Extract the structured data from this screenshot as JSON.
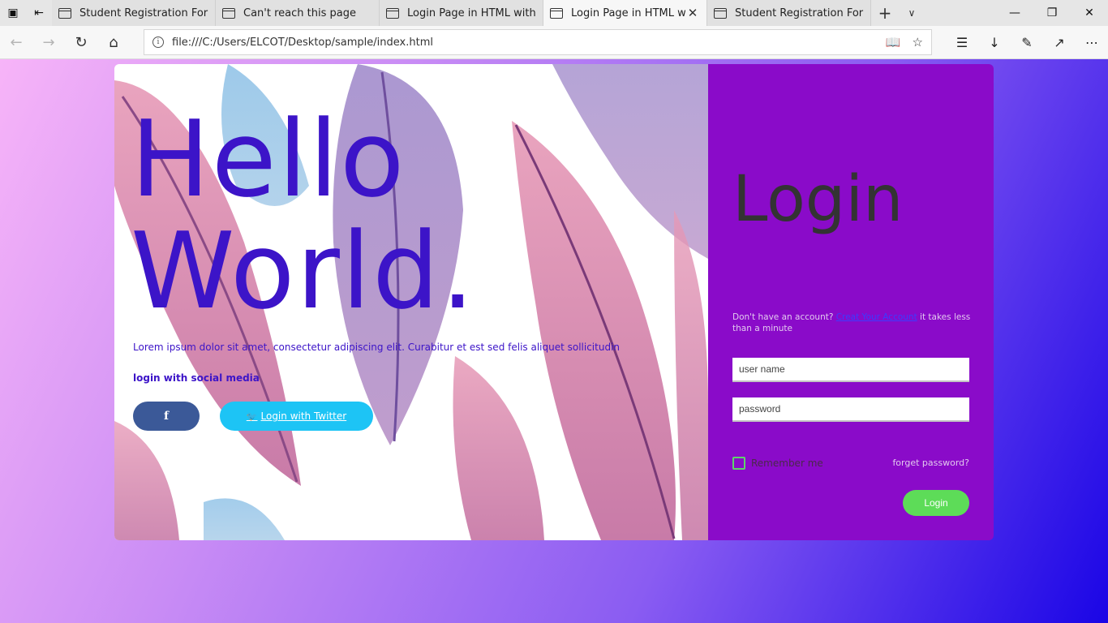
{
  "browser": {
    "tabs": [
      {
        "label": "Student Registration Form E",
        "active": false
      },
      {
        "label": "Can't reach this page",
        "active": false
      },
      {
        "label": "Login Page in HTML with CS",
        "active": false
      },
      {
        "label": "Login Page in HTML wit",
        "active": true
      },
      {
        "label": "Student Registration Form E",
        "active": false
      }
    ],
    "url": "file:///C:/Users/ELCOT/Desktop/sample/index.html",
    "icons": [
      "tabs-aside-icon",
      "set-aside-icon",
      "back-icon",
      "forward-icon",
      "refresh-icon",
      "home-icon",
      "reading-view-icon",
      "favorite-star-icon",
      "favorites-hub-icon",
      "downloads-icon",
      "notes-pen-icon",
      "share-icon",
      "more-icon"
    ]
  },
  "page": {
    "hero": {
      "line1": "Hello",
      "line2": "World."
    },
    "lorem": "Lorem ipsum dolor sit amet, consectetur adipiscing elit. Curabitur et est sed felis aliquet sollicitudin",
    "social_title": "login with social media",
    "facebook_label": "f",
    "twitter_label": "Login with Twitter"
  },
  "login": {
    "title": "Login",
    "signup_prefix": "Don't have an account?",
    "signup_link": "Creat Your Account",
    "signup_suffix": "it takes less than a minute",
    "username_placeholder": "user name",
    "password_placeholder": "password",
    "remember_label": "Remember me",
    "forget_label": "forget password?",
    "login_button": "Login"
  },
  "colors": {
    "hero_text": "#3c14c8",
    "right_panel": "#8a0bc9",
    "facebook": "#3b5998",
    "twitter": "#1dc4f5",
    "login_button": "#5ddc58",
    "checkbox_border": "#5fd36b"
  }
}
